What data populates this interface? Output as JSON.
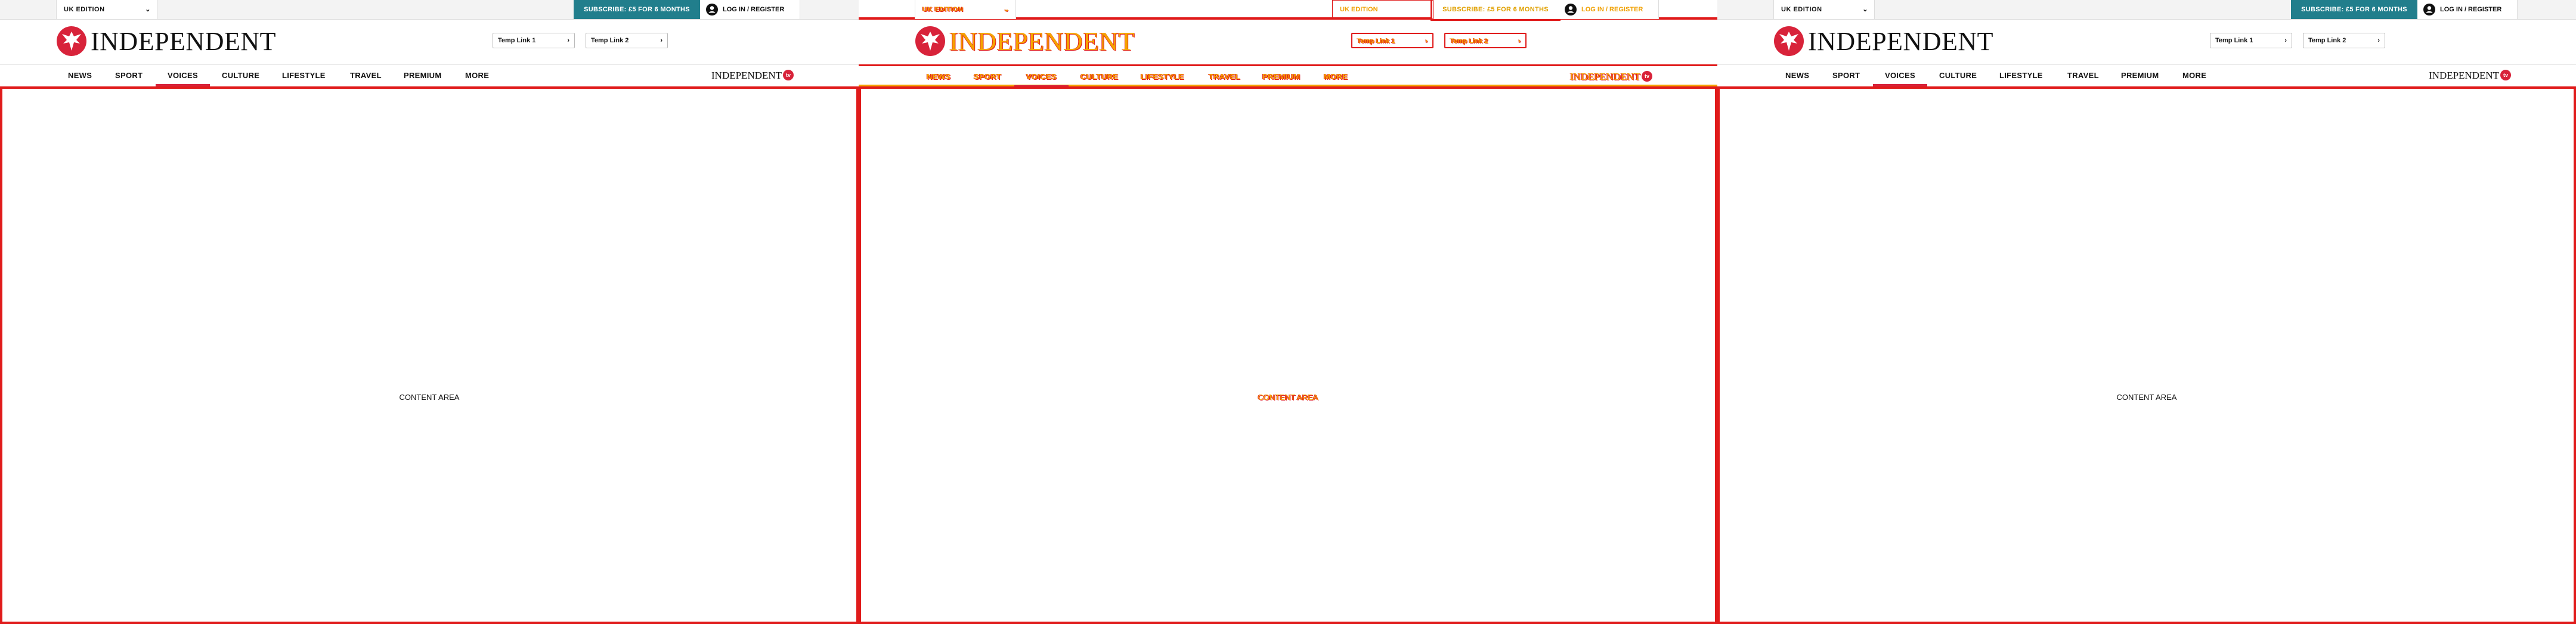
{
  "colors": {
    "accent": "#d8233a",
    "subscribe_bg": "#217e8c",
    "debug_outline": "#e01b1b",
    "debug_text": "#f5a300"
  },
  "panels": [
    {
      "edition": "UK EDITION",
      "subscribe": "SUBSCRIBE: £5 FOR 6 MONTHS",
      "login": "LOG IN / REGISTER",
      "logo_text": "INDEPENDENT",
      "temp_links": [
        "Temp Link 1",
        "Temp Link 2"
      ],
      "nav": [
        "NEWS",
        "SPORT",
        "VOICES",
        "CULTURE",
        "LIFESTYLE",
        "TRAVEL",
        "PREMIUM",
        "MORE"
      ],
      "active_nav": "VOICES",
      "tv_logo": "INDEPENDENT",
      "tv_badge": "tv",
      "content_label": "CONTENT AREA"
    },
    {
      "edition": "UK EDITION",
      "edition_secondary": "UK EDITION",
      "subscribe": "SUBSCRIBE: £5 FOR 6 MONTHS",
      "login": "LOG IN / REGISTER",
      "logo_text": "INDEPENDENT",
      "temp_links": [
        "Temp Link 1",
        "Temp Link 2"
      ],
      "nav": [
        "NEWS",
        "SPORT",
        "VOICES",
        "CULTURE",
        "LIFESTYLE",
        "TRAVEL",
        "PREMIUM",
        "MORE"
      ],
      "active_nav": "VOICES",
      "tv_logo": "INDEPENDENT",
      "tv_badge": "tv",
      "content_label": "CONTENT AREA"
    },
    {
      "edition": "UK EDITION",
      "subscribe": "SUBSCRIBE: £5 FOR 6 MONTHS",
      "login": "LOG IN / REGISTER",
      "logo_text": "INDEPENDENT",
      "temp_links": [
        "Temp Link 1",
        "Temp Link 2"
      ],
      "nav": [
        "NEWS",
        "SPORT",
        "VOICES",
        "CULTURE",
        "LIFESTYLE",
        "TRAVEL",
        "PREMIUM",
        "MORE"
      ],
      "active_nav": "VOICES",
      "tv_logo": "INDEPENDENT",
      "tv_badge": "tv",
      "content_label": "CONTENT AREA"
    }
  ]
}
